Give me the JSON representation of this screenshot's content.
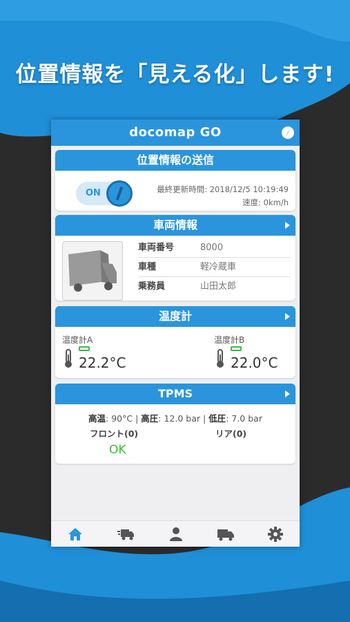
{
  "headline": "位置情報を「見える化」します!",
  "app": {
    "logo": "docomap GO",
    "logo_a": "docomap",
    "logo_b": "GO"
  },
  "location_card": {
    "title": "位置情報の送信",
    "toggle_label": "ON",
    "last_update": "最終更新時間: 2018/12/5 10:19:49",
    "speed": "速度: 0km/h"
  },
  "vehicle_card": {
    "title": "車両情報",
    "rows": [
      {
        "key": "車両番号",
        "value": "8000"
      },
      {
        "key": "車種",
        "value": "軽冷蔵車"
      },
      {
        "key": "乗務員",
        "value": "山田太郎"
      }
    ]
  },
  "temp_card": {
    "title": "温度計",
    "sensors": [
      {
        "label": "温度計A",
        "value": "22.2°C"
      },
      {
        "label": "温度計B",
        "value": "22.0°C"
      }
    ]
  },
  "tpms_card": {
    "title": "TPMS",
    "hi_temp_label": "高温",
    "hi_temp_value": ": 90°C | ",
    "hi_press_label": "高圧",
    "hi_press_value": ": 12.0 bar | ",
    "lo_press_label": "低圧",
    "lo_press_value": ": 7.0 bar",
    "front": "フロント(0)",
    "rear": "リア(0)",
    "status": "OK"
  },
  "tabs": [
    "home-icon",
    "delivery-truck-icon",
    "user-icon",
    "truck-icon",
    "gear-icon"
  ],
  "colors": {
    "primary": "#2a95dc",
    "ok": "#2ec62e",
    "background": "#2b2b2b",
    "tab_active": "#2a95dc",
    "tab_inactive": "#555555"
  }
}
